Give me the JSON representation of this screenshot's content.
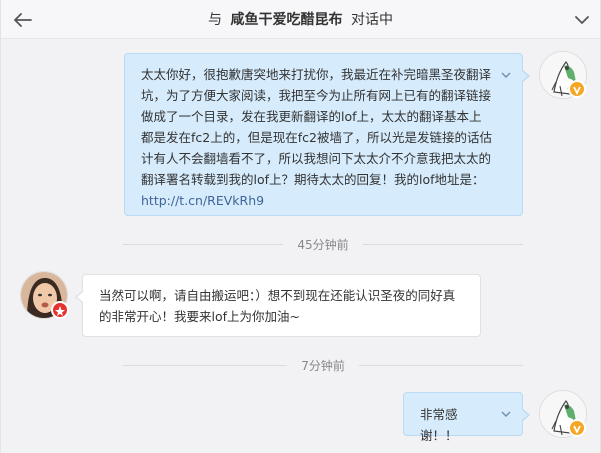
{
  "header": {
    "prefix": "与",
    "contact_name": "咸鱼干爱吃醋昆布",
    "suffix": "对话中",
    "back_icon": "arrow-left-icon",
    "collapse_icon": "chevron-down-icon"
  },
  "messages": [
    {
      "direction": "out",
      "text": "太太你好，很抱歉唐突地来打扰你，我最近在补完暗黑圣夜翻译坑，为了方便大家阅读，我把至今为止所有网上已有的翻译链接做成了一个目录，发在我更新翻译的lof上，太太的翻译基本上都是发在fc2上的，但是现在fc2被墙了，所以光是发链接的话估计有人不会翻墙看不了，所以我想问下太太介不介意我把太太的翻译署名转载到我的lof上？期待太太的回复！我的lof地址是：",
      "link": "http://t.cn/REVkRh9"
    },
    {
      "direction": "in",
      "text": "当然可以啊，请自由搬运吧：）想不到现在还能认识圣夜的同好真的非常开心！我要来lof上为你加油~"
    },
    {
      "direction": "out",
      "text": "非常感谢！！"
    }
  ],
  "timestamps": [
    "45分钟前",
    "7分钟前"
  ],
  "colors": {
    "bubble_out": "#d6ebfb",
    "bubble_in": "#ffffff",
    "link": "#406599",
    "badge_verified": "#f5a623",
    "badge_red": "#e6322d"
  }
}
